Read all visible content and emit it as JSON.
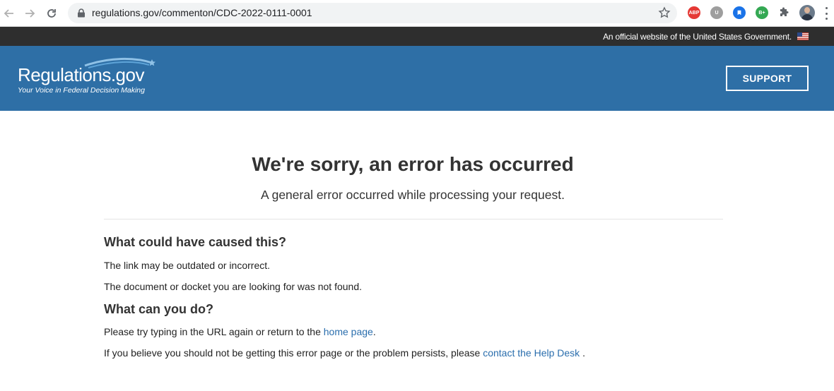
{
  "browser": {
    "url": "regulations.gov/commenton/CDC-2022-0111-0001",
    "extensions": [
      "ABP",
      "U",
      "",
      "B+"
    ]
  },
  "gov_banner": {
    "text": "An official website of the United States Government."
  },
  "header": {
    "logo_text": "Regulations.gov",
    "tagline": "Your Voice in Federal Decision Making",
    "support_label": "SUPPORT"
  },
  "main": {
    "title": "We're sorry, an error has occurred",
    "subtitle": "A general error occurred while processing your request.",
    "section1": {
      "heading": "What could have caused this?",
      "line1": "The link may be outdated or incorrect.",
      "line2": "The document or docket you are looking for was not found."
    },
    "section2": {
      "heading": "What can you do?",
      "line1_prefix": "Please try typing in the URL again or return to the ",
      "line1_link": "home page",
      "line1_suffix": ".",
      "line2_prefix": "If you believe you should not be getting this error page or the problem persists, please ",
      "line2_link": "contact the Help Desk",
      "line2_suffix": " ."
    }
  },
  "colors": {
    "header_bg": "#2e6fa6",
    "banner_bg": "#2e2e2e",
    "link": "#2a6ead"
  }
}
